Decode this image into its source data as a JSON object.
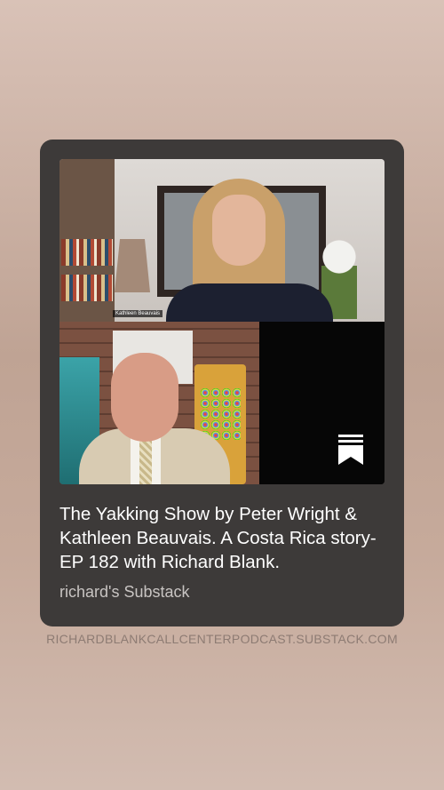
{
  "card": {
    "title": "The Yakking Show by Peter Wright & Kathleen Beauvais. A Costa Rica story- EP 182 with Richard Blank.",
    "source": "richard's Substack",
    "video": {
      "name_tag": "Kathleen Beauvais",
      "bookmark_icon": "bookmark-icon"
    }
  },
  "footer": {
    "url": "RICHARDBLANKCALLCENTERPODCAST.SUBSTACK.COM"
  },
  "colors": {
    "card_bg": "#3d3a39",
    "title": "#ffffff",
    "source": "#c8c4c2",
    "url": "#8d7b73"
  }
}
